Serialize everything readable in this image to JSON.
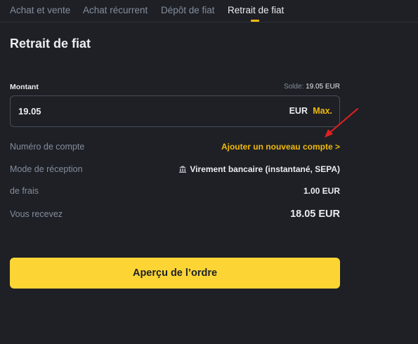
{
  "tabs": [
    {
      "label": "Achat et vente",
      "active": false
    },
    {
      "label": "Achat récurrent",
      "active": false
    },
    {
      "label": "Dépôt de fiat",
      "active": false
    },
    {
      "label": "Retrait de fiat",
      "active": true
    }
  ],
  "title": "Retrait de fiat",
  "amount": {
    "label": "Montant",
    "balance_label": "Solde:",
    "balance_value": "19.05 EUR",
    "value": "19.05",
    "currency": "EUR",
    "max_label": "Max."
  },
  "rows": {
    "account_label": "Numéro de compte",
    "account_action": "Ajouter un nouveau compte >",
    "method_label": "Mode de réception",
    "method_icon": "bank-icon",
    "method_value": "Virement bancaire (instantané, SEPA)",
    "fee_label": "de frais",
    "fee_value": "1.00 EUR",
    "receive_label": "Vous recevez",
    "receive_value": "18.05 EUR"
  },
  "submit_label": "Aperçu de l’ordre",
  "colors": {
    "background": "#1e2026",
    "accent": "#f0b90b",
    "button": "#fcd535",
    "annotation_arrow": "#e02020"
  }
}
